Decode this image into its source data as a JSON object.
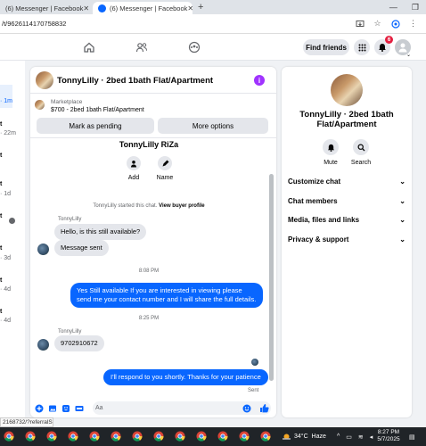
{
  "browser": {
    "tabs": [
      {
        "label": "(6) Messenger | Facebook",
        "active": false
      },
      {
        "label": "(6) Messenger | Facebook",
        "active": true
      }
    ],
    "url": "/t/9626114170758832",
    "status_url": "2168732/?referralS..."
  },
  "header": {
    "find_friends": "Find friends",
    "notification_count": "6"
  },
  "left_list": {
    "items": [
      {
        "time": "1m",
        "bold": false
      },
      {
        "time": "t",
        "bold": true
      },
      {
        "time": "22m",
        "bold": false
      },
      {
        "time": "t",
        "bold": true
      },
      {
        "time": "t",
        "bold": true
      },
      {
        "time": "1d",
        "bold": false
      },
      {
        "time": "t",
        "bold": true
      },
      {
        "time": "t",
        "bold": true
      },
      {
        "time": "3d",
        "bold": false
      },
      {
        "time": "t",
        "bold": true
      },
      {
        "time": "4d",
        "bold": false
      },
      {
        "time": "t",
        "bold": true
      },
      {
        "time": "4d",
        "bold": false
      }
    ]
  },
  "chat": {
    "title": "TonnyLilly · 2bed 1bath Flat/Apartment",
    "marketplace_label": "Marketplace",
    "listing": "$700 - 2bed 1bath Flat/Apartment",
    "mark_pending": "Mark as pending",
    "more_options": "More options",
    "profile_name": "TonnyLilly RiZa",
    "add_label": "Add",
    "name_label": "Name",
    "system_message_prefix": "TonnyLilly started this chat.",
    "system_message_link": "View buyer profile",
    "sender1": "TonnyLilly",
    "msg1": "Hello, is this still available?",
    "msg2": "Message sent",
    "time1": "8:08 PM",
    "msg3": "Yes Still available If you are interested in viewing please send me your contact number and I will share the full details.",
    "time2": "8:25 PM",
    "sender2": "TonnyLilly",
    "msg4": "9702910672",
    "msg5": "I'll respond to you shortly. Thanks for your patience",
    "sent_label": "Sent",
    "composer_placeholder": "Aa"
  },
  "details": {
    "title": "TonnyLilly · 2bed 1bath Flat/Apartment",
    "mute": "Mute",
    "search": "Search",
    "sections": [
      "Customize chat",
      "Chat members",
      "Media, files and links",
      "Privacy & support"
    ]
  },
  "taskbar": {
    "temperature": "34°C",
    "weather": "Haze",
    "time": "8:27 PM",
    "date": "5/7/2025"
  },
  "colors": {
    "accent": "#0866ff",
    "badge": "#e41e3f",
    "info": "#a033ff"
  }
}
